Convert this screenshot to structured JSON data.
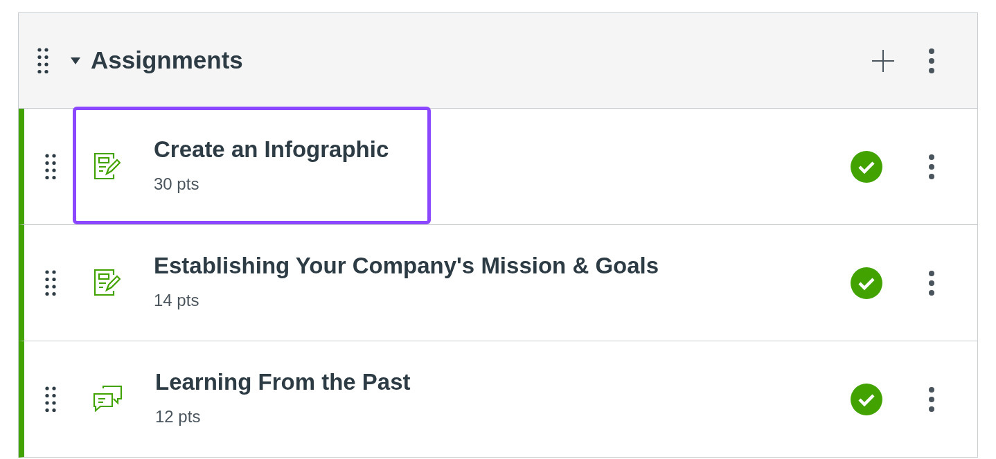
{
  "module": {
    "title": "Assignments",
    "expanded": true
  },
  "items": [
    {
      "kind": "assignment",
      "title": "Create an Infographic",
      "points": "30 pts",
      "published": true,
      "focused": true
    },
    {
      "kind": "assignment",
      "title": "Establishing Your Company's Mission & Goals",
      "points": "14 pts",
      "published": true,
      "focused": false
    },
    {
      "kind": "discussion",
      "title": "Learning From the Past",
      "points": "12 pts",
      "published": true,
      "focused": false
    }
  ]
}
